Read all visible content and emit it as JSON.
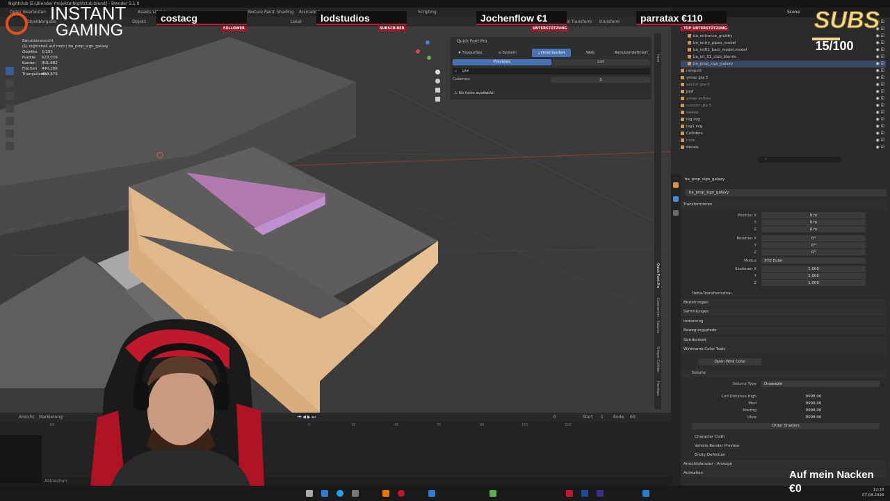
{
  "window": {
    "title": "Nightclub [E:\\Blender Projekte\\Nightclub.blend] - Blender 5.1.0"
  },
  "menu": [
    "Datei",
    "Bearbeiten",
    "Rendern",
    "Fenster",
    "Hilfe"
  ],
  "workspace_tabs": [
    "Assets Library",
    "Texture Paint",
    "Shading",
    "Animation",
    "Scripting"
  ],
  "scene_label": "Scene",
  "viewport": {
    "mode": "Objekt",
    "view_menus": [
      "Vorgabe",
      "Ansicht",
      "Auswählen",
      "Hinzufügen",
      "Objekt"
    ],
    "pivot": "Lokal",
    "header_info": "Benutzeransicht",
    "object_line": "(1) nightshell auf mob | ba_prop_sign_galaxy",
    "stats": [
      {
        "label": "Objekte",
        "value": "1/291"
      },
      {
        "label": "Punkte",
        "value": "523,039"
      },
      {
        "label": "Kanten",
        "value": "901,682"
      },
      {
        "label": "Flächen",
        "value": "440,288"
      },
      {
        "label": "Triangulieren",
        "value": "453,879"
      }
    ],
    "transform_label": "transform",
    "tool_header": "Tool Transform"
  },
  "quick_font": {
    "title": "Quick Font Pro",
    "tabs": [
      "Favourites",
      "System",
      "Downloaded",
      "Web",
      "Benutzerdefiniert"
    ],
    "active_tab": "Downloaded",
    "view_tabs": [
      "Previews",
      "List"
    ],
    "search_value": "gra",
    "columns_label": "Columns:",
    "columns_value": "1",
    "message": "No fonts available!"
  },
  "sidebar_tabs": [
    "Item",
    "Tool",
    "View",
    "Procedural Signs",
    "A-Tools",
    "BB Assets",
    "Zen UV",
    "VCC",
    "Game Ready LOD",
    "Quick Font Pro",
    "Colorwriter - Solumz",
    "Simple Collider",
    "Hardops",
    "gta 5"
  ],
  "outliner": {
    "search_placeholder": "",
    "rows": [
      {
        "name": "import",
        "indent": 0
      },
      {
        "name": "import2",
        "indent": 0
      },
      {
        "name": "ba_entrance_grubby",
        "indent": 1
      },
      {
        "name": "ba_entry_pipes_model",
        "indent": 1
      },
      {
        "name": "ba_int01_bact_model.model",
        "indent": 1
      },
      {
        "name": "ba_int_01_club_blends",
        "indent": 1
      },
      {
        "name": "ba_prop_sign_galaxy",
        "indent": 1
      },
      {
        "name": "remport",
        "indent": 0
      },
      {
        "name": "ymap gta 5",
        "indent": 0
      },
      {
        "name": "vector gta 5",
        "indent": 0
      },
      {
        "name": "ped",
        "indent": 0
      },
      {
        "name": "ymap setbov",
        "indent": 0
      },
      {
        "name": "custom gta 5",
        "indent": 0
      },
      {
        "name": "sweep",
        "indent": 0
      },
      {
        "name": "log.svg",
        "indent": 0
      },
      {
        "name": "log1.svg",
        "indent": 0
      },
      {
        "name": "Colliders",
        "indent": 0
      },
      {
        "name": "mob",
        "indent": 0
      },
      {
        "name": "decals",
        "indent": 0
      }
    ]
  },
  "properties": {
    "object_name": "ba_prop_sign_galaxy",
    "object_name2": "ba_prop_sign_galaxy",
    "transform_header": "Transformieren",
    "position": [
      {
        "label": "Position X",
        "value": "0 m"
      },
      {
        "label": "Y",
        "value": "0 m"
      },
      {
        "label": "Z",
        "value": "0 m"
      }
    ],
    "rotation": [
      {
        "label": "Rotation X",
        "value": "0°"
      },
      {
        "label": "Y",
        "value": "0°"
      },
      {
        "label": "Z",
        "value": "0°"
      }
    ],
    "mode_label": "Modus",
    "mode_value": "XYZ Euler",
    "scale": [
      {
        "label": "Skalieren X",
        "value": "1.000"
      },
      {
        "label": "Y",
        "value": "1.000"
      },
      {
        "label": "Z",
        "value": "1.000"
      }
    ],
    "sections": [
      "Delta-Transformation",
      "Beziehungen",
      "Sammlungen",
      "Instancing",
      "Bewegungspfade",
      "Sichtbarkeit",
      "Wireframe Color Tools"
    ],
    "wire_button": "Open Wire Color",
    "solumz_header": "Solumz",
    "solumz_type_label": "Solumz Type",
    "solumz_type_value": "Drawable",
    "lod": [
      {
        "label": "Lod Distance High",
        "value": "9998.00"
      },
      {
        "label": "Med",
        "value": "9998.00"
      },
      {
        "label": "Niedrig",
        "value": "9998.00"
      },
      {
        "label": "Vlow",
        "value": "9998.00"
      }
    ],
    "order_button": "Order Shaders",
    "subsections": [
      "Character Cloth",
      "Vehicle Render Preview",
      "Entity Definition"
    ],
    "bottom_sections": [
      "Ansichtsfenster - Anzeige",
      "Animation"
    ]
  },
  "timeline": {
    "menus": [
      "Ansicht",
      "Markierung"
    ],
    "current_frame": "0",
    "start_label": "Start",
    "start_value": "1",
    "end_label": "Ende",
    "end_value": "60",
    "ticks": [
      "-60",
      "0",
      "15",
      "30",
      "45",
      "60",
      "75",
      "90",
      "105",
      "120",
      "135"
    ]
  },
  "status_bar": [
    "Bestätigen",
    "Abbrechen"
  ],
  "overlay": {
    "logo_line1": "INSTANT",
    "logo_line2": "GAMING",
    "donors": [
      {
        "name": "costacg",
        "tag": "FOLLOWER"
      },
      {
        "name": "lodstudios",
        "tag": "SUBSCRIBER"
      },
      {
        "name": "Jochenflow €1",
        "tag": "UNTERSTÜTZUNG"
      },
      {
        "name": "parratax €110",
        "tag": "TOP UNTERSTÜTZUNG"
      }
    ],
    "subs_label": "SUBS",
    "subs_count": "15/100",
    "nacken_label": "Auf mein Nacken",
    "nacken_value": "€0"
  },
  "taskbar": {
    "time": "12:16",
    "date": "07.04.2026"
  },
  "colors": {
    "accent": "#4772b3",
    "selection_orange": "#e8a04a",
    "donor_red": "#c0182c"
  }
}
